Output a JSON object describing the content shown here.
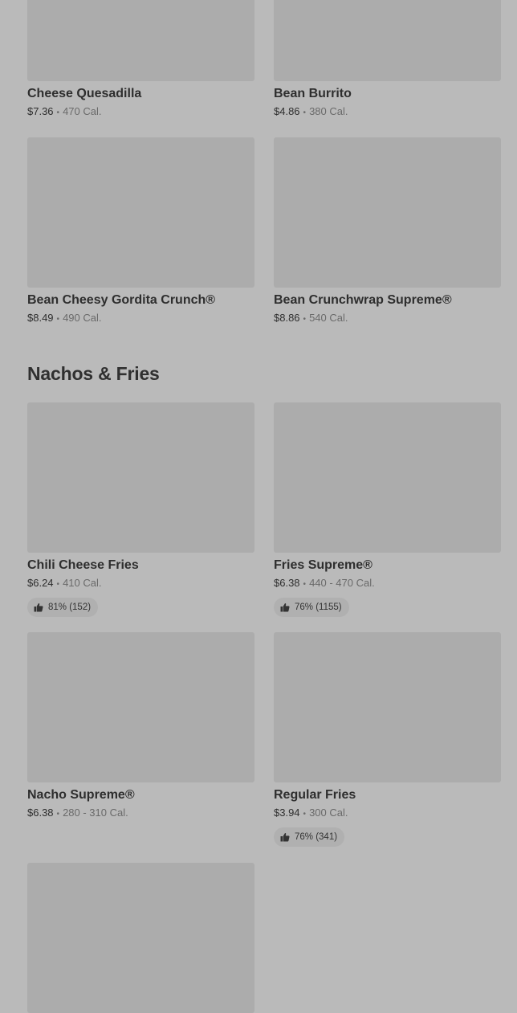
{
  "sections": [
    {
      "items": [
        {
          "name": "Cheese Quesadilla",
          "price": "$7.36",
          "calories": "470 Cal."
        },
        {
          "name": "Bean Burrito",
          "price": "$4.86",
          "calories": "380 Cal."
        },
        {
          "name": "Bean Cheesy Gordita Crunch®",
          "price": "$8.49",
          "calories": "490 Cal."
        },
        {
          "name": "Bean Crunchwrap Supreme®",
          "price": "$8.86",
          "calories": "540 Cal."
        }
      ]
    },
    {
      "title": "Nachos & Fries",
      "items": [
        {
          "name": "Chili Cheese Fries",
          "price": "$6.24",
          "calories": "410 Cal.",
          "rating": "81% (152)"
        },
        {
          "name": "Fries Supreme®",
          "price": "$6.38",
          "calories": "440 - 470 Cal.",
          "rating": "76% (1155)"
        },
        {
          "name": "Nacho Supreme®",
          "price": "$6.38",
          "calories": "280 - 310 Cal."
        },
        {
          "name": "Regular Fries",
          "price": "$3.94",
          "calories": "300 Cal.",
          "rating": "76% (341)"
        }
      ]
    }
  ],
  "icons": {
    "rating": "thumbs-up-icon"
  },
  "colors": {
    "background": "#bababa",
    "placeholder": "#acacac",
    "rating_pill": "#b0b0b0"
  }
}
